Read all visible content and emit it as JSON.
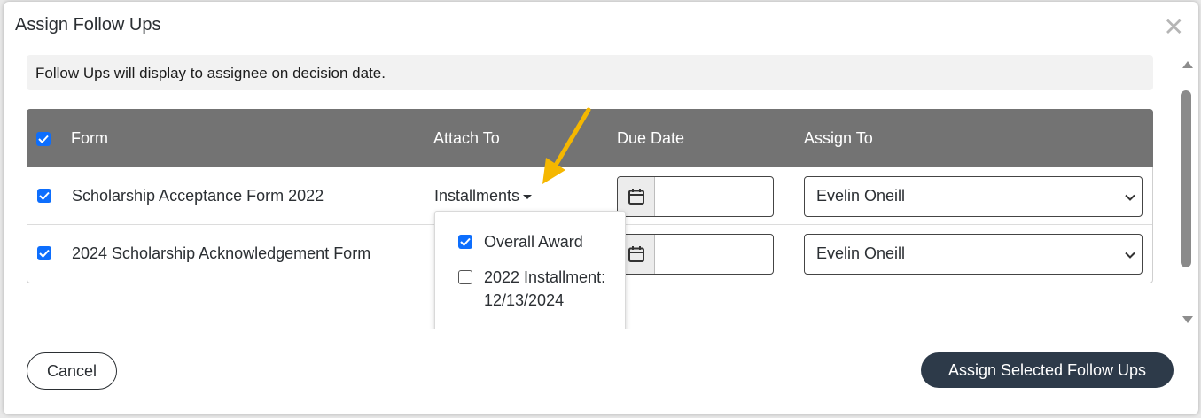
{
  "modal": {
    "title": "Assign Follow Ups",
    "close_icon": "close-icon"
  },
  "info": {
    "message": "Follow Ups will display to assignee on decision date."
  },
  "table": {
    "headers": {
      "select_all_checked": true,
      "form": "Form",
      "attach_to": "Attach To",
      "due_date": "Due Date",
      "assign_to": "Assign To"
    },
    "rows": [
      {
        "checked": true,
        "form": "Scholarship Acceptance Form 2022",
        "attach_to": "Installments",
        "due_date": "",
        "assign_to": "Evelin Oneill"
      },
      {
        "checked": true,
        "form": "2024 Scholarship Acknowledgement Form",
        "attach_to": "",
        "due_date": "",
        "assign_to": "Evelin Oneill"
      }
    ]
  },
  "attach_dropdown": {
    "items": [
      {
        "label": "Overall Award",
        "checked": true
      },
      {
        "label_line1": "2022 Installment:",
        "label_line2": "12/13/2024",
        "checked": false
      }
    ]
  },
  "footer": {
    "cancel_label": "Cancel",
    "assign_label": "Assign Selected Follow Ups"
  },
  "colors": {
    "header_bg": "#737373",
    "checkbox_blue": "#0d6efd",
    "primary_button": "#2d3a49",
    "annotation_arrow": "#f5b700"
  }
}
